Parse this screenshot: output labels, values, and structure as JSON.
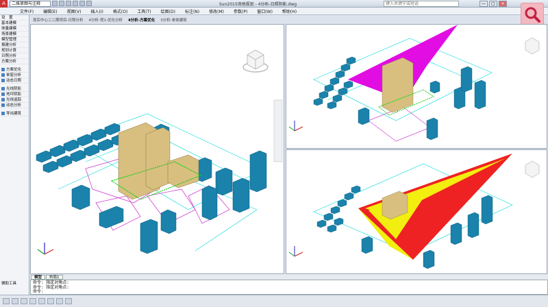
{
  "titlebar": {
    "workspace": "二维草图与注释",
    "doc_title": "Sun2015场地规划 - 4分析-日照阴影.dwg",
    "search_placeholder": "键入关键字或短语",
    "min": "—",
    "max": "□",
    "close": "×"
  },
  "menu": [
    "文件(F)",
    "编辑(E)",
    "视图(V)",
    "插入(I)",
    "格式(O)",
    "工具(T)",
    "绘图(D)",
    "标注(N)",
    "修改(M)",
    "参数(P)",
    "窗口(W)",
    "帮助(H)"
  ],
  "palette": {
    "items": [
      "设　置",
      "基本建模",
      "体量建模",
      "场景建模",
      "模型管理",
      "报建分析",
      "规划计算",
      "日照分析",
      "方案分析"
    ],
    "tools": [
      "方案优化",
      "单窗分析",
      "动态日照"
    ],
    "tools2": [
      "光线阴影",
      "地坪阴影",
      "光线追踪",
      "动态分析"
    ],
    "tools3": [
      "导出建筑"
    ],
    "bottom_label": "辅助工具"
  },
  "doc_tabs": [
    "现实中心二二期项目-日照分析",
    "4分析-塔1-优化分析",
    "4分析-方案优化",
    "3分析-单体建筑"
  ],
  "active_tab": 2,
  "layout_tabs": [
    "模型",
    "布局1"
  ],
  "command_lines": [
    "命令: 指定对角点:",
    "命令: 指定对角点:",
    "命令:"
  ],
  "colors": {
    "building": "#1a82ab",
    "target": "#d8bf80",
    "shadow_a": "#e000e0",
    "shadow_b": "#ee2222",
    "shadow_c": "#f2ee10",
    "site": "#d040d0",
    "edge": "#18d018"
  }
}
